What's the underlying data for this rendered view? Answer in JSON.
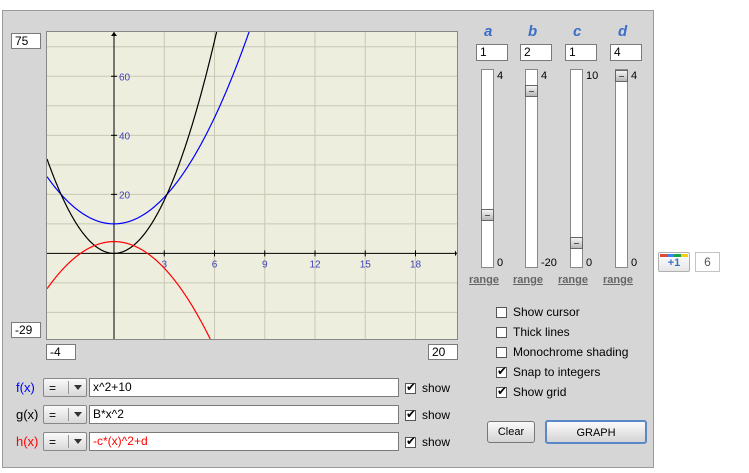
{
  "graph": {
    "ymax": "75",
    "ymin": "-29",
    "xmin": "-4",
    "xmax": "20",
    "x_ticks": [
      "3",
      "6",
      "9",
      "12",
      "15",
      "18"
    ],
    "y_ticks": [
      "20",
      "40",
      "60"
    ],
    "colors": {
      "f": "#0000ff",
      "g": "#000000",
      "h": "#ff0000",
      "grid": "#c8c8b4",
      "background": "#eeeede",
      "ticks": "#4040b8"
    }
  },
  "params": [
    {
      "name": "a",
      "value": "1",
      "max": "4",
      "min": "0",
      "position": 0.25,
      "range_label": "range"
    },
    {
      "name": "b",
      "value": "2",
      "max": "4",
      "min": "-20",
      "position": 0.917,
      "range_label": "range"
    },
    {
      "name": "c",
      "value": "1",
      "max": "10",
      "min": "0",
      "position": 0.1,
      "range_label": "range"
    },
    {
      "name": "d",
      "value": "4",
      "max": "4",
      "min": "0",
      "position": 1.0,
      "range_label": "range"
    }
  ],
  "options": [
    {
      "label": "Show cursor",
      "checked": false
    },
    {
      "label": "Thick lines",
      "checked": false
    },
    {
      "label": "Monochrome shading",
      "checked": false
    },
    {
      "label": "Snap to integers",
      "checked": true
    },
    {
      "label": "Show grid",
      "checked": true
    }
  ],
  "functions": [
    {
      "label": "f(x)",
      "op": "=",
      "expr": "x^2+10",
      "show_label": "show",
      "show": true,
      "color": "#0000ff"
    },
    {
      "label": "g(x)",
      "op": "=",
      "expr": "B*x^2",
      "show_label": "show",
      "show": true,
      "color": "#000000"
    },
    {
      "label": "h(x)",
      "op": "=",
      "expr": "-c*(x)^2+d",
      "show_label": "show",
      "show": true,
      "color": "#ff0000"
    }
  ],
  "buttons": {
    "clear": "Clear",
    "graph": "GRAPH"
  },
  "social": {
    "plus_label": "+1",
    "count": "6"
  }
}
